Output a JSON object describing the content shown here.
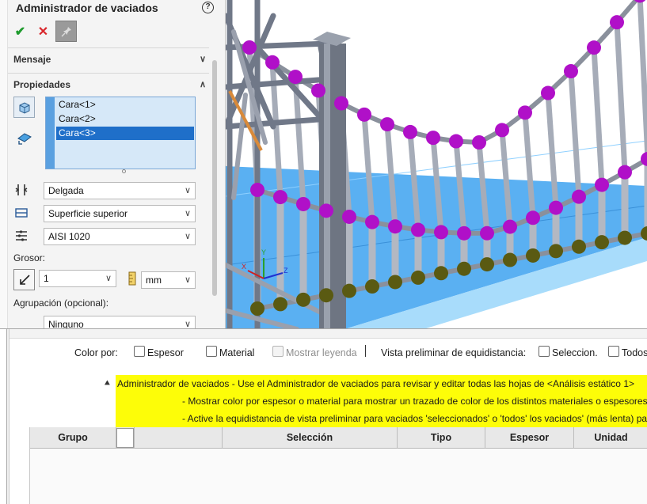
{
  "property_manager": {
    "title": "Administrador de vaciados",
    "help_symbol": "?",
    "ok_symbol": "✔",
    "cancel_symbol": "✕",
    "sections": {
      "mensaje": "Mensaje",
      "propiedades": "Propiedades"
    },
    "faces": [
      "Cara<1>",
      "Cara<2>",
      "Cara<3>"
    ],
    "selected_face_index": 2,
    "shell_type": "Delgada",
    "offset": "Superficie superior",
    "material": "AISI 1020",
    "thickness_label": "Grosor:",
    "thickness_value": "1",
    "unit": "mm",
    "grouping_label": "Agrupación (opcional):",
    "grouping_value": "Ninguno"
  },
  "dock": {
    "color_by_label": "Color por:",
    "options": {
      "espesor": "Espesor",
      "material": "Material",
      "mostrar_leyenda": "Mostrar leyenda",
      "separator": "|",
      "vista_preliminar": "Vista preliminar de equidistancia:",
      "seleccion": "Seleccion.",
      "todos": "Todos"
    },
    "info_lines": [
      "Administrador de vaciados - Use el Administrador de vaciados para revisar y editar todas las hojas de <Análisis estático 1>",
      "- Mostrar color por espesor o material para mostrar un trazado de color de los distintos materiales o espesores de",
      "- Active la equidistancia de vista preliminar para vaciados 'seleccionados' o 'todos' los vaciados' (más lenta) para ge"
    ],
    "table_headers": {
      "grupo": "Grupo",
      "seleccion": "Selección",
      "tipo": "Tipo",
      "espesor": "Espesor",
      "unidad": "Unidad"
    }
  },
  "triad": {
    "x": "X",
    "y": "Y",
    "z": "Z"
  },
  "colors": {
    "list_selection": "#1f6fc9",
    "info_background": "#fdfd08",
    "node_magenta": "#b010c8",
    "node_olive": "#5a5a12",
    "floor_blue": "#5ab0f2"
  }
}
